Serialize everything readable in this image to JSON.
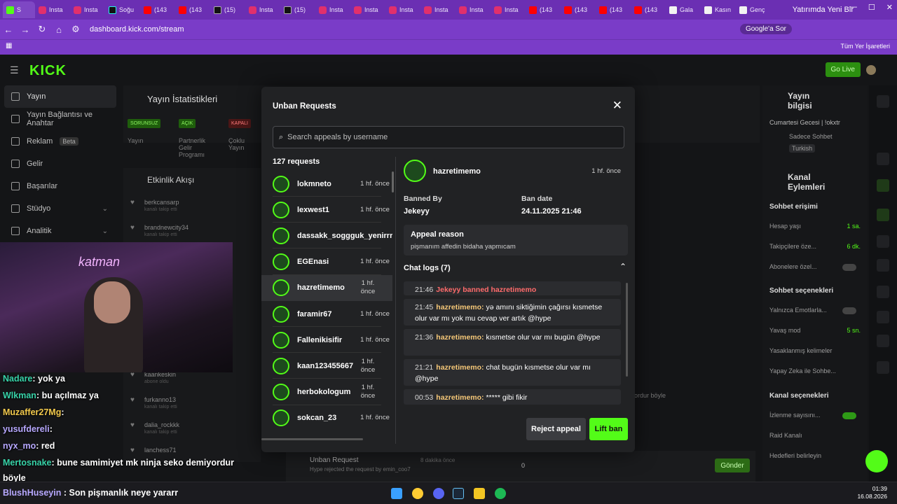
{
  "browser": {
    "tabs": [
      {
        "label": "S",
        "favicon": "kick"
      },
      {
        "label": "Insta",
        "favicon": "ig"
      },
      {
        "label": "Insta",
        "favicon": "ig"
      },
      {
        "label": "Soğu",
        "favicon": "tt"
      },
      {
        "label": "(143",
        "favicon": "yt"
      },
      {
        "label": "(143",
        "favicon": "yt"
      },
      {
        "label": "(15)",
        "favicon": "x"
      },
      {
        "label": "Insta",
        "favicon": "ig"
      },
      {
        "label": "(15)",
        "favicon": "x"
      },
      {
        "label": "Insta",
        "favicon": "ig"
      },
      {
        "label": "Insta",
        "favicon": "ig"
      },
      {
        "label": "Insta",
        "favicon": "ig"
      },
      {
        "label": "Insta",
        "favicon": "ig"
      },
      {
        "label": "Insta",
        "favicon": "ig"
      },
      {
        "label": "Insta",
        "favicon": "ig"
      },
      {
        "label": "(143",
        "favicon": "yt"
      },
      {
        "label": "(143",
        "favicon": "yt"
      },
      {
        "label": "(143",
        "favicon": "yt"
      },
      {
        "label": "(143",
        "favicon": "yt"
      },
      {
        "label": "Gala",
        "favicon": "doc"
      },
      {
        "label": "Kasın",
        "favicon": "doc"
      },
      {
        "label": "Genç",
        "favicon": "doc"
      }
    ],
    "window_title_fragment": "Yatırımda Yeni Bir",
    "url": "dashboard.kick.com/stream",
    "google_pill": "Google'a Sor",
    "bookmarks_label": "Tüm Yer İşaretleri"
  },
  "dashboard": {
    "logo": "KICK",
    "go_live": "Go Live",
    "sidebar": [
      {
        "label": "Yayın",
        "active": true
      },
      {
        "label": "Yayın Bağlantısı ve Anahtar",
        "active": false
      },
      {
        "label": "Reklam",
        "badge": "Beta",
        "active": false
      },
      {
        "label": "Gelir",
        "active": false
      },
      {
        "label": "Başarılar",
        "active": false
      },
      {
        "label": "Stüdyo",
        "chevron": true,
        "active": false
      },
      {
        "label": "Analitik",
        "chevron": true,
        "active": false
      }
    ],
    "stats_title": "Yayın İstatistikleri",
    "stat_badges": [
      "SORUNSUZ",
      "AÇIK",
      "KAPALI"
    ],
    "stat_labels": [
      "Yayın",
      "Partnerlik Gelir Programı",
      "Çoklu Yayın"
    ],
    "activity_title": "Etkinlik Akışı",
    "activity": [
      {
        "user": "berkcansarp",
        "sub": "kanalı takip etti"
      },
      {
        "user": "brandnewcity34",
        "sub": "kanalı takip etti"
      },
      {
        "user": "kaankeskin",
        "sub": "abone oldu"
      },
      {
        "user": "furkanno13",
        "sub": "kanalı takip etti"
      },
      {
        "user": "dalia_rockkk",
        "sub": "kanalı takip etti"
      },
      {
        "user": "lanchess71",
        "sub": ""
      }
    ],
    "right_panel": {
      "stream_info_title": "Yayın bilgisi",
      "stream_title": "Cumartesi Gecesi | !okxtr",
      "category": "Sadece Sohbet",
      "language": "Turkish",
      "channel_actions_title": "Kanal Eylemleri",
      "chat_access_title": "Sohbet erişimi",
      "rows": [
        {
          "label": "Hesap yaşı",
          "value": "1 sa."
        },
        {
          "label": "Takipçilere öze...",
          "value": "6 dk."
        },
        {
          "label": "Abonelere özel...",
          "value": ""
        }
      ],
      "chat_options_title": "Sohbet seçenekleri",
      "rows2": [
        {
          "label": "Yalnızca Emotlarla...",
          "value": ""
        },
        {
          "label": "Yavaş mod",
          "value": "5 sn."
        },
        {
          "label": "Yasaklanmış kelimeler",
          "value": ""
        },
        {
          "label": "Yapay Zeka ile Sohbe...",
          "value": ""
        }
      ],
      "channel_options_title": "Kanal seçenekleri",
      "rows3": [
        {
          "label": "İzlenme sayısını..."
        },
        {
          "label": "Raid Kanalı"
        },
        {
          "label": "Hedefleri belirleyin"
        }
      ]
    },
    "bottom": {
      "unban_title": "Unban Request",
      "unban_sub": "Hype rejected the request by emin_coo7",
      "unban_time": "8 dakika önce",
      "viewer_count": "0",
      "send": "Gönder",
      "mid_chat": "ordur böyle"
    }
  },
  "modal": {
    "title": "Unban Requests",
    "search_placeholder": "Search appeals by username",
    "count_label": "127 requests",
    "requests": [
      {
        "name": "lokmneto",
        "time": "1 hf. önce"
      },
      {
        "name": "lexwest1",
        "time": "1 hf. önce"
      },
      {
        "name": "dassakk_soggguk_yenirrrss",
        "time": ""
      },
      {
        "name": "EGEnasi",
        "time": "1 hf. önce"
      },
      {
        "name": "hazretimemo",
        "time": "1 hf. önce",
        "selected": true
      },
      {
        "name": "faramir67",
        "time": "1 hf. önce"
      },
      {
        "name": "Fallenikisifir",
        "time": "1 hf. önce"
      },
      {
        "name": "kaan123455667",
        "time": "1 hf. önce"
      },
      {
        "name": "herbokologum",
        "time": "1 hf. önce"
      },
      {
        "name": "sokcan_23",
        "time": "1 hf. önce"
      }
    ],
    "detail": {
      "username": "hazretimemo",
      "time": "1 hf. önce",
      "banned_by_label": "Banned By",
      "banned_by": "Jekeyy",
      "ban_date_label": "Ban date",
      "ban_date": "24.11.2025 21:46",
      "appeal_reason_label": "Appeal reason",
      "appeal_reason": "pişmanım affedin bidaha yapmıcam",
      "chat_logs_label": "Chat logs (7)",
      "logs": [
        {
          "time": "21:46",
          "system": "Jekeyy banned hazretimemo"
        },
        {
          "time": "21:45",
          "user": "hazretimemo:",
          "text": "yə amını siktiğimin çağırsı kısmetse olur var mı yok mu cevap ver artık @hype"
        },
        {
          "time": "21:36",
          "user": "hazretimemo:",
          "text": "kısmetse olur var mı bugün @hype"
        },
        {
          "time": "21:21",
          "user": "hazretimemo:",
          "text": "chat bugün kısmetse olur var mı @hype"
        },
        {
          "time": "00:53",
          "user": "hazretimemo:",
          "text": "***** gibi fikir"
        }
      ]
    },
    "reject_label": "Reject appeal",
    "lift_label": "Lift ban"
  },
  "stream_overlay": {
    "neon_sign": "katman",
    "chat": [
      {
        "user": "Nadare",
        "text": ": yok ya"
      },
      {
        "user": "Wlkman",
        "text": ": bu açılmaz ya"
      },
      {
        "user": "Muzaffer27Mg",
        "text": ":"
      },
      {
        "user": "yusufdereli",
        "text": ":"
      },
      {
        "user": "nyx_mo",
        "text": ": red"
      },
      {
        "user": "Mertosnake",
        "text": ": bune samimiyet mk ninja seko demiyordur"
      },
      {
        "user": "",
        "text": "böyle"
      },
      {
        "user": "BlushHuseyin",
        "text": ": Son pişmanlık neye yararr"
      }
    ]
  },
  "taskbar": {
    "time": "01:39",
    "date": "16.08.2026"
  }
}
